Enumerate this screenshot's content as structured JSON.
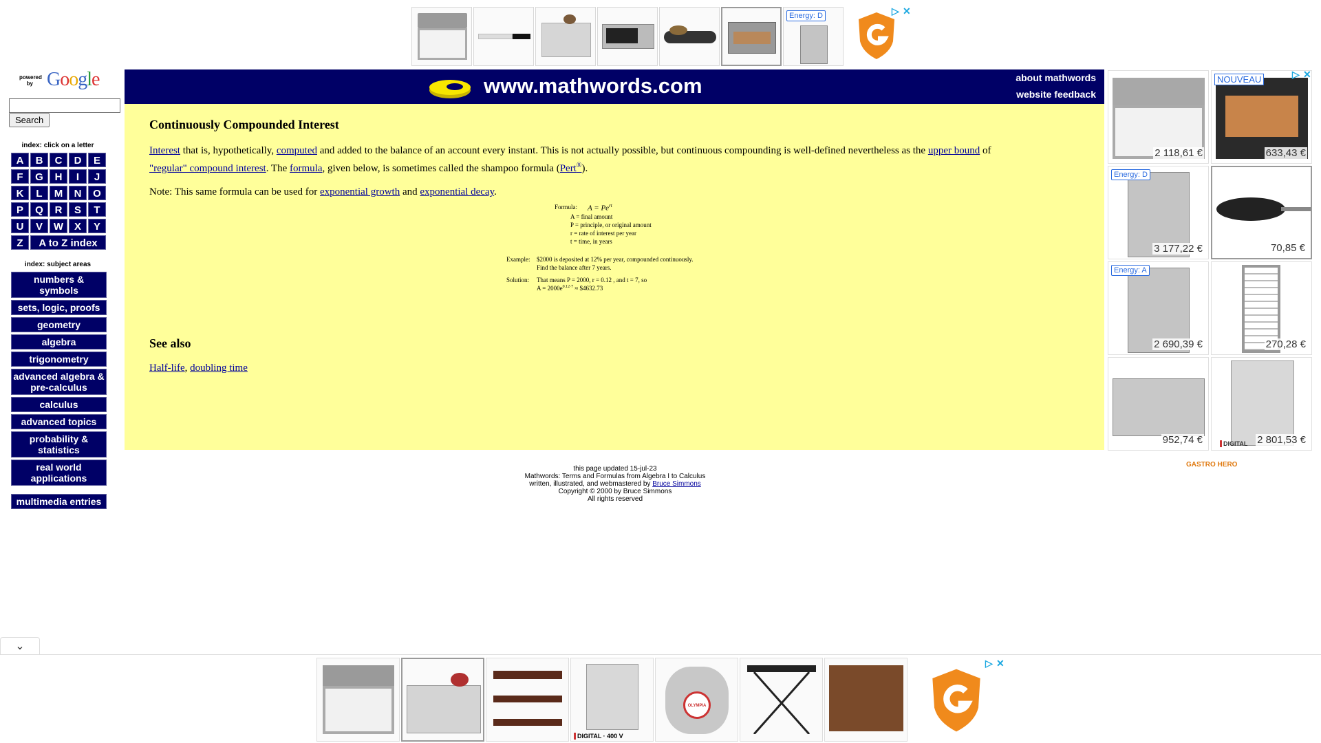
{
  "top_ad": {
    "energy_badge": "Energy: D",
    "adchoices_icon": "ad-choices-icon",
    "close_icon": "close-icon"
  },
  "sidebar": {
    "powered_by": "powered by",
    "google_logo": "Google",
    "search_value": "",
    "search_button": "Search",
    "letter_index_title": "index: click on a letter",
    "letters": [
      [
        "A",
        "B",
        "C",
        "D",
        "E"
      ],
      [
        "F",
        "G",
        "H",
        "I",
        "J"
      ],
      [
        "K",
        "L",
        "M",
        "N",
        "O"
      ],
      [
        "P",
        "Q",
        "R",
        "S",
        "T"
      ],
      [
        "U",
        "V",
        "W",
        "X",
        "Y"
      ]
    ],
    "letter_z": "Z",
    "a_to_z": "A to Z index",
    "subject_index_title": "index: subject areas",
    "subjects": [
      "numbers & symbols",
      "sets, logic, proofs",
      "geometry",
      "algebra",
      "trigonometry",
      "advanced algebra & pre-calculus",
      "calculus",
      "advanced topics",
      "probability & statistics",
      "real world applications"
    ],
    "multimedia": "multimedia entries"
  },
  "banner": {
    "site_title": "www.mathwords.com",
    "about_link": "about mathwords",
    "feedback_link": "website feedback"
  },
  "article": {
    "title": "Continuously Compounded Interest",
    "p1": {
      "interest": "Interest",
      "t1": " that is, hypothetically, ",
      "computed": "computed",
      "t2": " and added to the balance of an account every instant. This is not actually possible, but continuous compounding is well-defined nevertheless as the ",
      "upper_bound": "upper bound",
      "t3": " of",
      "regular": "\"regular\" compound interest",
      "t4": ". The ",
      "formula": "formula",
      "t5": ", given below, is sometimes called the shampoo formula (",
      "pert": "Pert",
      "reg": "®",
      "t6": ")."
    },
    "p2": {
      "t1": "Note: This same formula can be used for ",
      "growth": "exponential growth",
      "t2": " and ",
      "decay": "exponential decay",
      "t3": "."
    },
    "formula_image": {
      "formula_label": "Formula:",
      "formula": "A = Pe",
      "formula_exp": "rt",
      "defs": [
        "A = final amount",
        "P = principle, or original amount",
        "r = rate of interest per year",
        "t = time, in years"
      ],
      "example_label": "Example:",
      "example_1": "$2000 is deposited at 12% per year, compounded continuously.",
      "example_2": "Find the balance after 7 years.",
      "solution_label": "Solution:",
      "solution_1": "That means  P = 2000, r = 0.12 , and t = 7, so",
      "solution_2": "A = 2000e",
      "solution_exp": "0.12·7",
      "solution_3": " ≈ $4632.73"
    },
    "see_also_title": "See also",
    "see_also": {
      "half_life": "Half-life",
      "sep": ", ",
      "doubling": "doubling time"
    }
  },
  "footer": {
    "updated": "this page updated 15-jul-23",
    "line2": "Mathwords: Terms and Formulas from Algebra I to Calculus",
    "line3_pre": "written, illustrated, and webmastered by ",
    "author_link": "Bruce Simmons",
    "line4": "Copyright © 2000 by Bruce Simmons",
    "line5": "All rights reserved"
  },
  "right_ad": {
    "tiles": [
      {
        "price": "2 118,61 €",
        "badge": ""
      },
      {
        "price": "633,43 €",
        "badge": "NOUVEAU"
      },
      {
        "price": "3 177,22 €",
        "badge": "Energy: D"
      },
      {
        "price": "70,85 €",
        "badge": ""
      },
      {
        "price": "2 690,39 €",
        "badge": "Energy: A"
      },
      {
        "price": "270,28 €",
        "badge": ""
      },
      {
        "price": "952,74 €",
        "badge": ""
      },
      {
        "price": "2 801,53 €",
        "badge": ""
      }
    ],
    "digital_label": "DIGITAL",
    "brand": "GASTRO HERO"
  },
  "bottom_ad": {
    "digital_label": "DIGITAL · 400 V",
    "olympia": "OLYMPIA"
  },
  "colors": {
    "navy": "#000066",
    "content_bg": "#ffff9a",
    "link": "#00009c",
    "gastro_orange": "#f08a1c",
    "adchoices_blue": "#1aa7e0"
  }
}
